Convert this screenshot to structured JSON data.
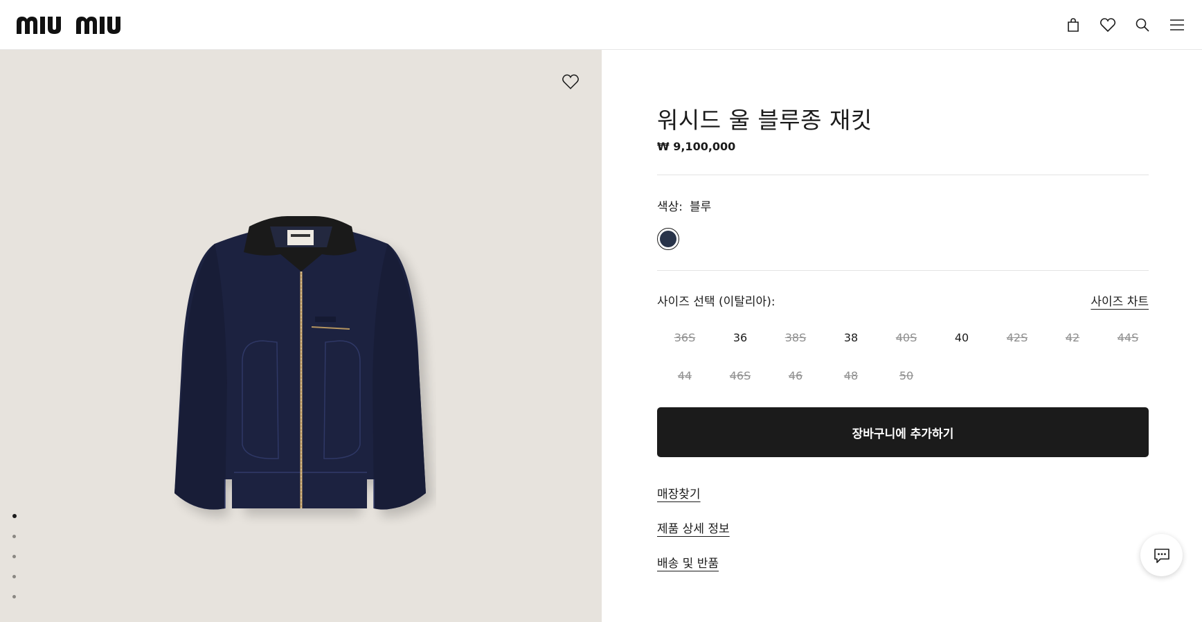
{
  "header": {
    "logo_text": "miu miu",
    "icons": [
      "bag-icon",
      "heart-icon",
      "search-icon",
      "menu-icon"
    ]
  },
  "gallery": {
    "background": "#e7e3dd",
    "favorite_icon": "heart-icon",
    "slide_count": 5,
    "active_slide": 1
  },
  "product": {
    "title": "워시드 울 블루종 재킷",
    "price": "₩ 9,100,000",
    "color_label": "색상:",
    "color_value": "블루",
    "swatch_color": "#29344a",
    "size_label": "사이즈 선택 (이탈리아):",
    "size_chart_label": "사이즈 차트",
    "sizes": [
      {
        "label": "36S",
        "available": false
      },
      {
        "label": "36",
        "available": true
      },
      {
        "label": "38S",
        "available": false
      },
      {
        "label": "38",
        "available": true
      },
      {
        "label": "40S",
        "available": false
      },
      {
        "label": "40",
        "available": true
      },
      {
        "label": "42S",
        "available": false
      },
      {
        "label": "42",
        "available": false
      },
      {
        "label": "44S",
        "available": false
      },
      {
        "label": "44",
        "available": false
      },
      {
        "label": "46S",
        "available": false
      },
      {
        "label": "46",
        "available": false
      },
      {
        "label": "48",
        "available": false
      },
      {
        "label": "50",
        "available": false
      }
    ],
    "add_to_cart_label": "장바구니에 추가하기",
    "links": {
      "store_locator": "매장찾기",
      "product_details": "제품 상세 정보",
      "shipping_returns": "배송 및 반품"
    }
  },
  "chat": {
    "icon": "chat-icon"
  }
}
